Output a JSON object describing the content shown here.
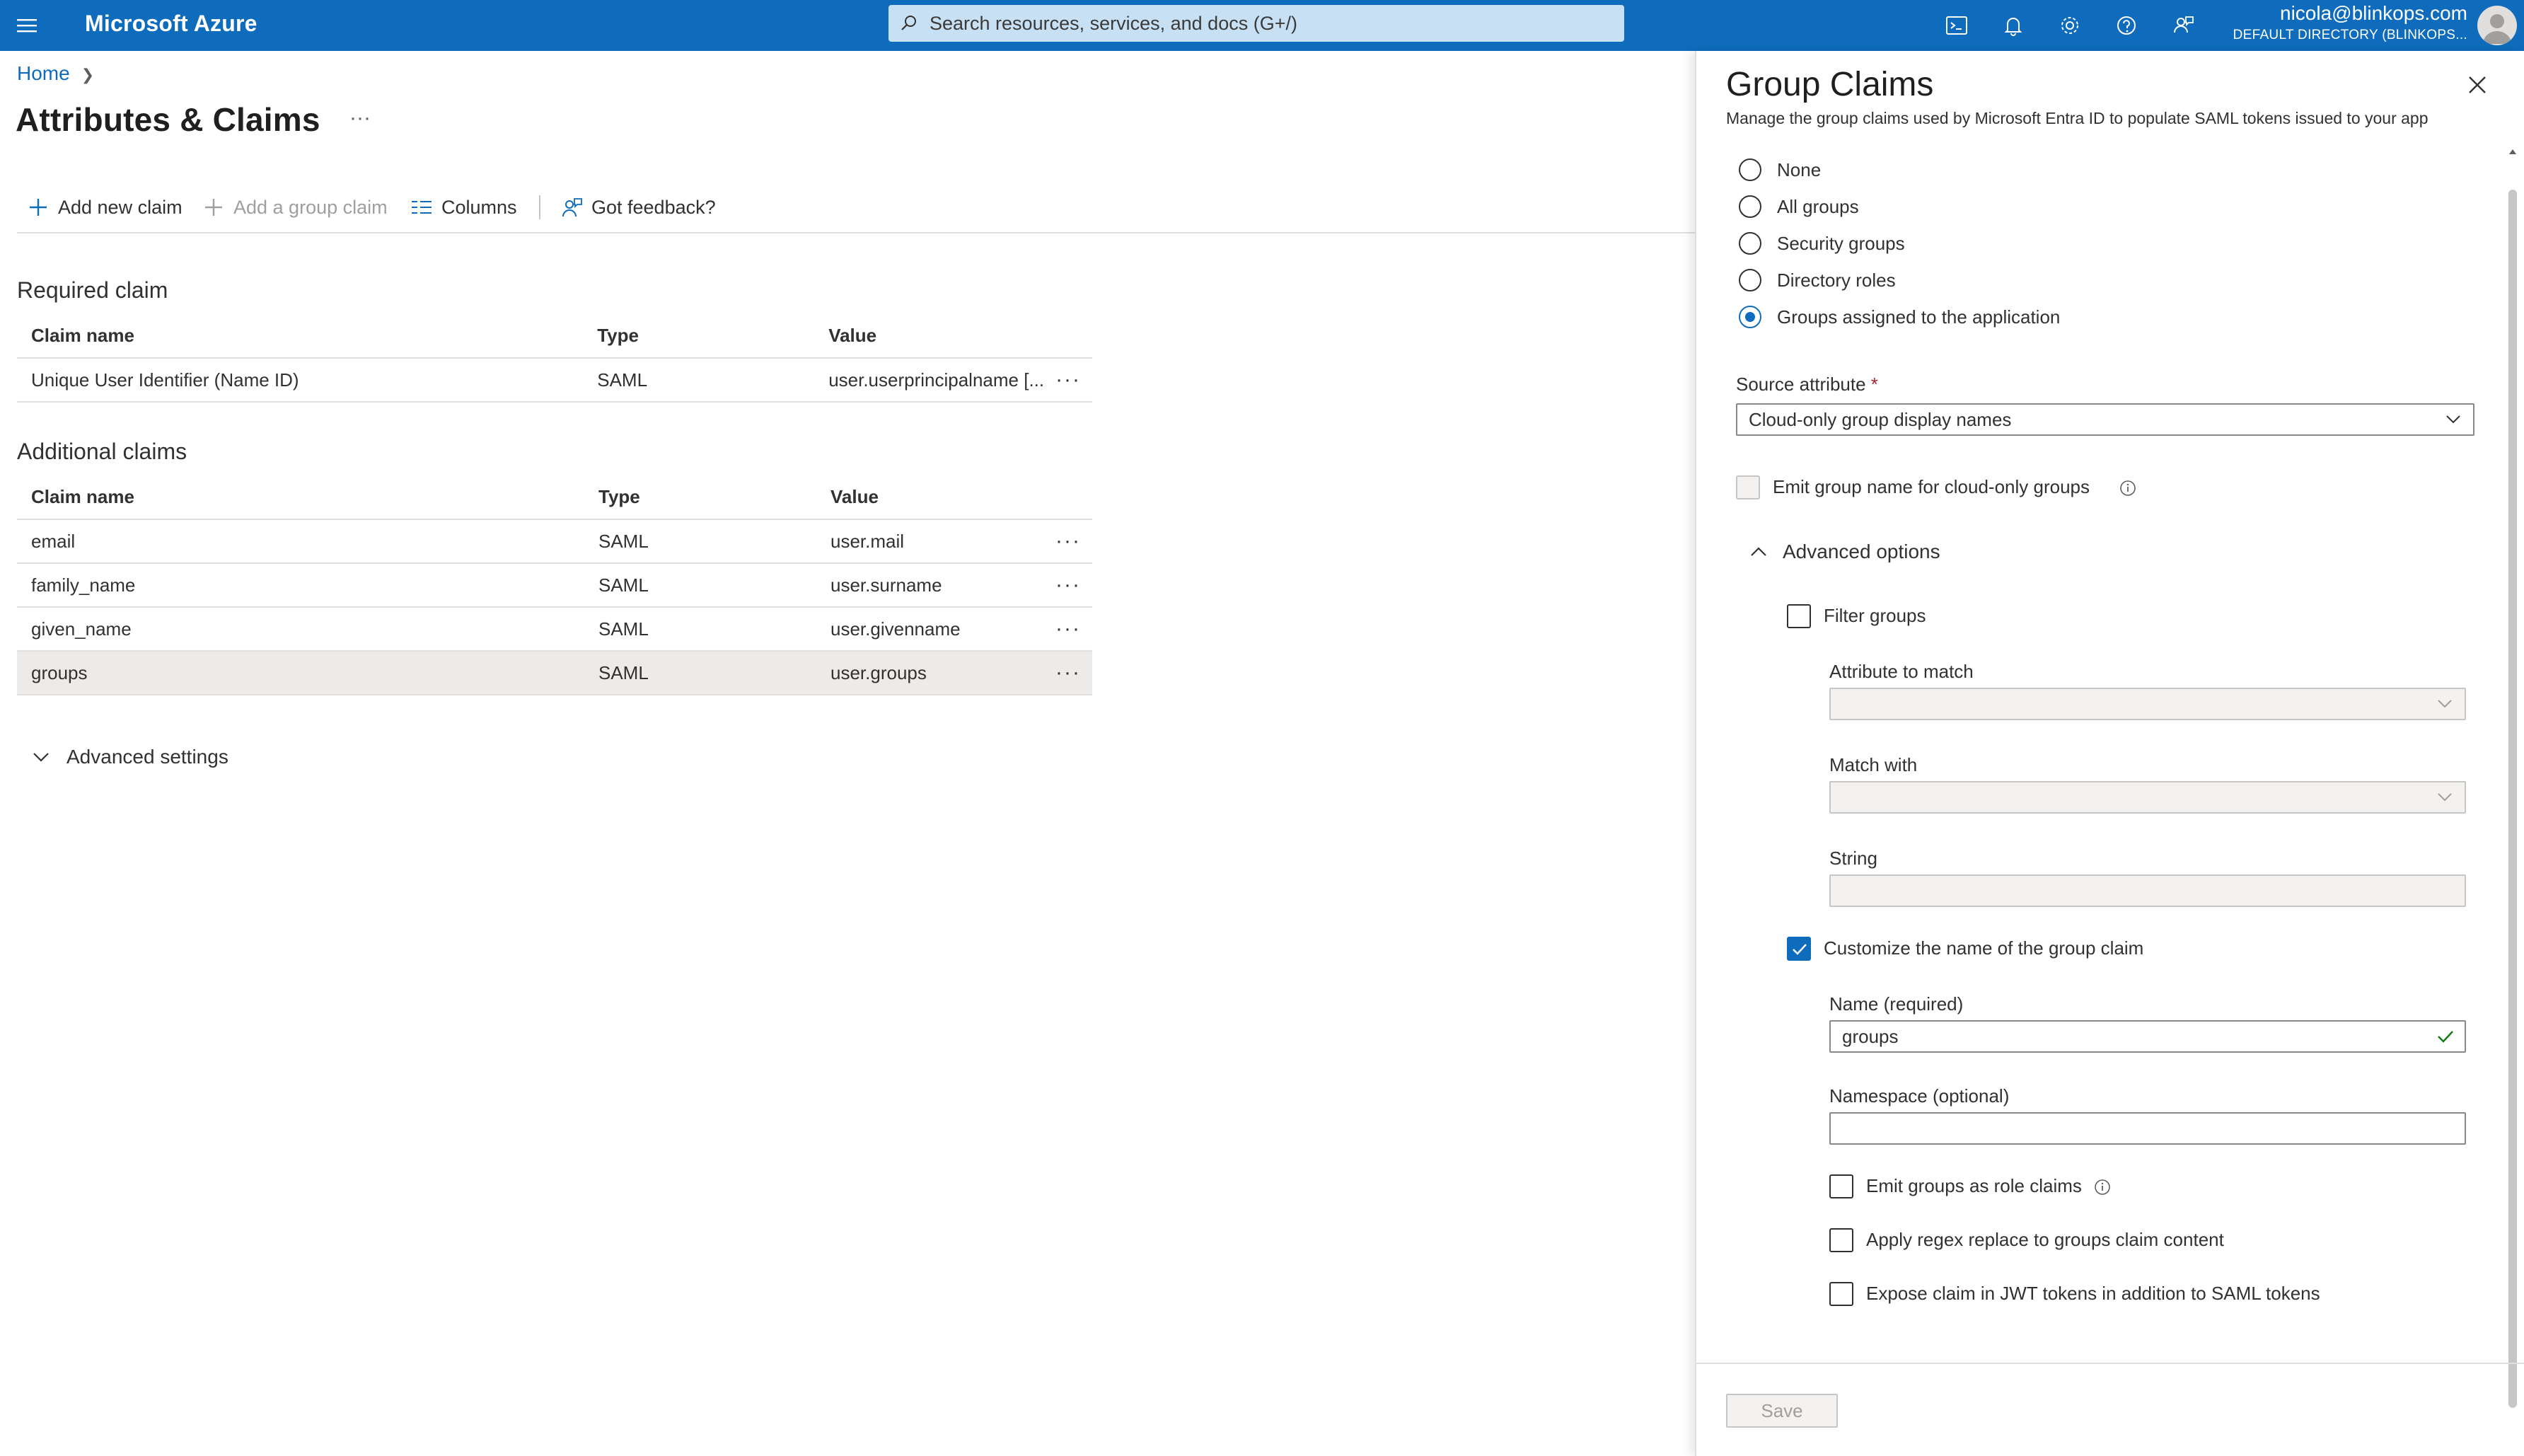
{
  "topbar": {
    "brand": "Microsoft Azure",
    "search_placeholder": "Search resources, services, and docs (G+/)",
    "user_email": "nicola@blinkops.com",
    "user_directory": "DEFAULT DIRECTORY (BLINKOPS...",
    "icons": [
      "cloud-shell-icon",
      "bell-icon",
      "gear-icon",
      "help-icon",
      "feedback-icon"
    ]
  },
  "breadcrumb": {
    "home": "Home"
  },
  "page": {
    "title": "Attributes & Claims",
    "more": "···"
  },
  "toolbar": {
    "add_claim": "Add new claim",
    "add_group_claim": "Add a group claim",
    "columns": "Columns",
    "feedback": "Got feedback?"
  },
  "required": {
    "title": "Required claim",
    "headers": [
      "Claim name",
      "Type",
      "Value"
    ],
    "rows": [
      {
        "name": "Unique User Identifier (Name ID)",
        "type": "SAML",
        "value": "user.userprincipalname [..."
      }
    ]
  },
  "additional": {
    "title": "Additional claims",
    "headers": [
      "Claim name",
      "Type",
      "Value"
    ],
    "rows": [
      {
        "name": "email",
        "type": "SAML",
        "value": "user.mail"
      },
      {
        "name": "family_name",
        "type": "SAML",
        "value": "user.surname"
      },
      {
        "name": "given_name",
        "type": "SAML",
        "value": "user.givenname"
      },
      {
        "name": "groups",
        "type": "SAML",
        "value": "user.groups"
      }
    ],
    "selected_row": 3
  },
  "advanced_settings": "Advanced settings",
  "row_actions": "···",
  "panel": {
    "title": "Group Claims",
    "subtitle": "Manage the group claims used by Microsoft Entra ID to populate SAML tokens issued to your app",
    "radios": [
      {
        "label": "None",
        "selected": false
      },
      {
        "label": "All groups",
        "selected": false
      },
      {
        "label": "Security groups",
        "selected": false
      },
      {
        "label": "Directory roles",
        "selected": false
      },
      {
        "label": "Groups assigned to the application",
        "selected": true
      }
    ],
    "source_attribute_label": "Source attribute",
    "required_mark": "*",
    "source_attribute_value": "Cloud-only group display names",
    "emit_cloud_only": "Emit group name for cloud-only groups",
    "advanced_options": "Advanced options",
    "filter_groups": "Filter groups",
    "attribute_to_match": "Attribute to match",
    "match_with": "Match with",
    "string": "String",
    "customize_name": "Customize the name of the group claim",
    "customize_checked": true,
    "name_label": "Name (required)",
    "name_value": "groups",
    "namespace_label": "Namespace (optional)",
    "namespace_value": "",
    "emit_role_claims": "Emit groups as role claims",
    "apply_regex": "Apply regex replace to groups claim content",
    "expose_jwt": "Expose claim in JWT tokens in addition to SAML tokens",
    "save": "Save"
  },
  "colors": {
    "accent": "#0f6cbd",
    "search_bg": "#c7e0f4",
    "selected_row": "#edebe9",
    "valid": "#107c10"
  }
}
